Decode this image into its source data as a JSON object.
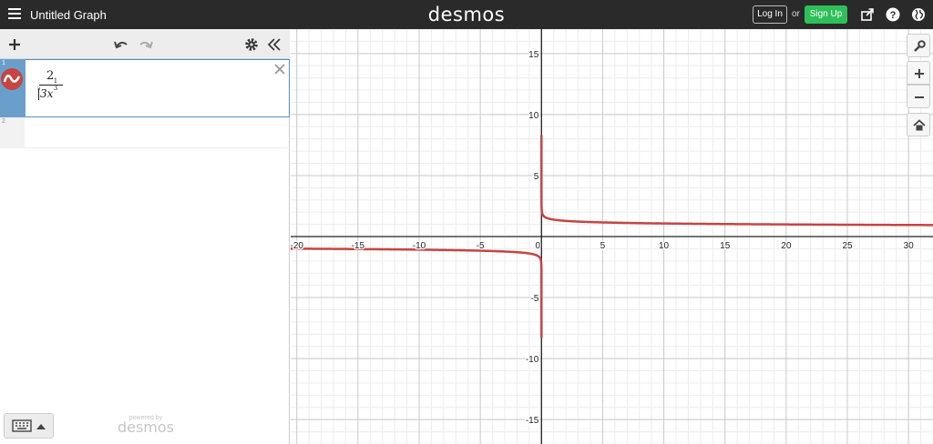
{
  "header": {
    "title": "Untitled Graph",
    "logo": "desmos",
    "login_label": "Log In",
    "or_label": "or",
    "signup_label": "Sign Up",
    "icons": [
      "menu-icon",
      "share-icon",
      "help-icon",
      "globe-icon"
    ]
  },
  "expression_panel": {
    "toolbar_icons": [
      "add-icon",
      "undo-icon",
      "redo-icon",
      "gear-icon",
      "collapse-icon"
    ],
    "expressions": [
      {
        "index": "1",
        "latex": "\\frac{2}{\\sqrt[3]{3x^{\\frac{1}{3}}}}",
        "numerator": "2",
        "root_index": "3",
        "denominator": "3x",
        "exponent_num": "1",
        "exponent_den": "3",
        "color": "#c74440"
      },
      {
        "index": "2",
        "latex": ""
      }
    ],
    "keyboard_icon": "keyboard-icon",
    "powered_by_label": "powered by",
    "powered_by_logo": "desmos"
  },
  "graph": {
    "x_range": [
      -20.5,
      32
    ],
    "y_range": [
      -17,
      17
    ],
    "x_ticks": [
      "-20",
      "-15",
      "-10",
      "-5",
      "0",
      "5",
      "10",
      "15",
      "20",
      "25",
      "30"
    ],
    "y_ticks": [
      "15",
      "10",
      "5",
      "-5",
      "-10",
      "-15"
    ],
    "curve_color": "#c74440",
    "grid": true
  },
  "controls": {
    "icons": [
      "wrench-icon",
      "zoom-in-icon",
      "zoom-out-icon",
      "home-icon"
    ]
  }
}
